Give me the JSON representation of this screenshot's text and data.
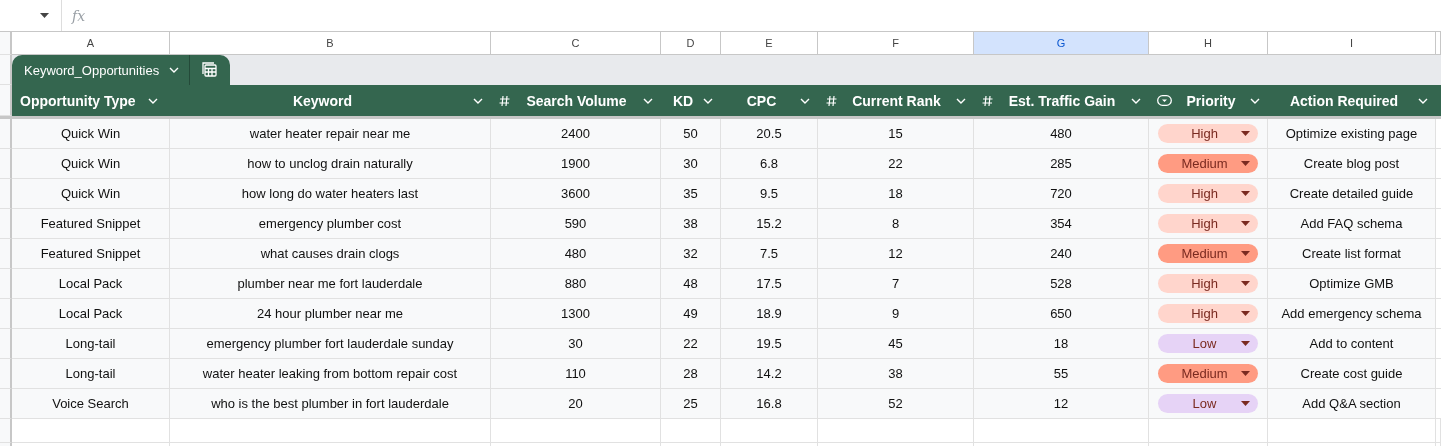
{
  "formula_bar": {
    "fx_label": "fx"
  },
  "column_letters": [
    {
      "label": "A",
      "selected": false
    },
    {
      "label": "B",
      "selected": false
    },
    {
      "label": "C",
      "selected": false
    },
    {
      "label": "D",
      "selected": false
    },
    {
      "label": "E",
      "selected": false
    },
    {
      "label": "F",
      "selected": false
    },
    {
      "label": "G",
      "selected": true
    },
    {
      "label": "H",
      "selected": false
    },
    {
      "label": "I",
      "selected": false
    }
  ],
  "table": {
    "name": "Keyword_Opportunities",
    "columns": [
      {
        "label": "Opportunity Type",
        "kind": "text"
      },
      {
        "label": "Keyword",
        "kind": "text"
      },
      {
        "label": "Search Volume",
        "kind": "number"
      },
      {
        "label": "KD",
        "kind": "text"
      },
      {
        "label": "CPC",
        "kind": "text"
      },
      {
        "label": "Current Rank",
        "kind": "number"
      },
      {
        "label": "Est. Traffic Gain",
        "kind": "number"
      },
      {
        "label": "Priority",
        "kind": "dropdown"
      },
      {
        "label": "Action Required",
        "kind": "text"
      }
    ],
    "rows": [
      {
        "cells": [
          "Quick Win",
          "water heater repair near me",
          "2400",
          "50",
          "20.5",
          "15",
          "480"
        ],
        "priority": {
          "label": "High",
          "color": "#ffd5cc"
        },
        "action": "Optimize existing page"
      },
      {
        "cells": [
          "Quick Win",
          "how to unclog drain naturally",
          "1900",
          "30",
          "6.8",
          "22",
          "285"
        ],
        "priority": {
          "label": "Medium",
          "color": "#ff9b82"
        },
        "action": "Create blog post"
      },
      {
        "cells": [
          "Quick Win",
          "how long do water heaters last",
          "3600",
          "35",
          "9.5",
          "18",
          "720"
        ],
        "priority": {
          "label": "High",
          "color": "#ffd5cc"
        },
        "action": "Create detailed guide"
      },
      {
        "cells": [
          "Featured Snippet",
          "emergency plumber cost",
          "590",
          "38",
          "15.2",
          "8",
          "354"
        ],
        "priority": {
          "label": "High",
          "color": "#ffd5cc"
        },
        "action": "Add FAQ schema"
      },
      {
        "cells": [
          "Featured Snippet",
          "what causes drain clogs",
          "480",
          "32",
          "7.5",
          "12",
          "240"
        ],
        "priority": {
          "label": "Medium",
          "color": "#ff9b82"
        },
        "action": "Create list format"
      },
      {
        "cells": [
          "Local Pack",
          "plumber near me fort lauderdale",
          "880",
          "48",
          "17.5",
          "7",
          "528"
        ],
        "priority": {
          "label": "High",
          "color": "#ffd5cc"
        },
        "action": "Optimize GMB"
      },
      {
        "cells": [
          "Local Pack",
          "24 hour plumber near me",
          "1300",
          "49",
          "18.9",
          "9",
          "650"
        ],
        "priority": {
          "label": "High",
          "color": "#ffd5cc"
        },
        "action": "Add emergency schema"
      },
      {
        "cells": [
          "Long-tail",
          "emergency plumber fort lauderdale sunday",
          "30",
          "22",
          "19.5",
          "45",
          "18"
        ],
        "priority": {
          "label": "Low",
          "color": "#e6d3f6"
        },
        "action": "Add to content"
      },
      {
        "cells": [
          "Long-tail",
          "water heater leaking from bottom repair cost",
          "110",
          "28",
          "14.2",
          "38",
          "55"
        ],
        "priority": {
          "label": "Medium",
          "color": "#ff9b82"
        },
        "action": "Create cost guide"
      },
      {
        "cells": [
          "Voice Search",
          "who is the best plumber in fort lauderdale",
          "20",
          "25",
          "16.8",
          "52",
          "12"
        ],
        "priority": {
          "label": "Low",
          "color": "#e6d3f6"
        },
        "action": "Add Q&A section"
      }
    ]
  }
}
